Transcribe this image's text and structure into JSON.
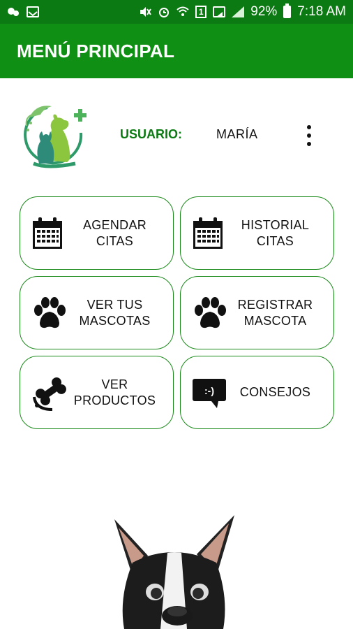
{
  "status_bar": {
    "battery": "92%",
    "time": "7:18 AM",
    "sim_badge": "1"
  },
  "app_bar": {
    "title": "MENÚ PRINCIPAL"
  },
  "header": {
    "user_label": "USUARIO:",
    "user_name": "MARÍA"
  },
  "menu": [
    {
      "label": "AGENDAR\nCITAS",
      "icon": "calendar-icon"
    },
    {
      "label": "HISTORIAL\nCITAS",
      "icon": "calendar-icon"
    },
    {
      "label": "VER TUS\nMASCOTAS",
      "icon": "paw-icon"
    },
    {
      "label": "REGISTRAR\nMASCOTA",
      "icon": "paw-icon"
    },
    {
      "label": "VER\nPRODUCTOS",
      "icon": "bone-collar-icon"
    },
    {
      "label": "CONSEJOS",
      "icon": "chat-bubble-icon"
    }
  ],
  "colors": {
    "status_bar": "#0b7a12",
    "app_bar": "#0f8f13",
    "accent_green": "#0b7a12",
    "card_border": "#1a8a1a"
  }
}
